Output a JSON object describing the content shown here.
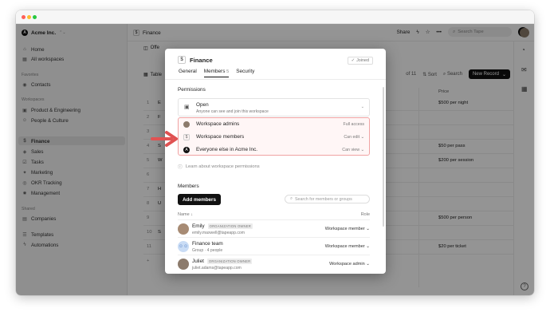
{
  "workspace": {
    "name": "Acme Inc.",
    "logo_letter": "A"
  },
  "sidebar": {
    "top": [
      {
        "icon": "home-icon",
        "glyph": "⌂",
        "label": "Home"
      },
      {
        "icon": "grid-icon",
        "glyph": "▦",
        "label": "All workspaces"
      }
    ],
    "favorites_title": "Favorites",
    "favorites": [
      {
        "icon": "contacts-icon",
        "glyph": "◉",
        "label": "Contacts"
      }
    ],
    "workspaces_title": "Workspaces",
    "workspaces": [
      {
        "icon": "briefcase-icon",
        "glyph": "▣",
        "label": "Product & Engineering"
      },
      {
        "icon": "people-icon",
        "glyph": "☺",
        "label": "People & Culture"
      },
      {
        "icon": "dollar-icon",
        "glyph": "$",
        "label": "Finance"
      },
      {
        "icon": "sales-icon",
        "glyph": "◈",
        "label": "Sales"
      },
      {
        "icon": "tasks-icon",
        "glyph": "☑",
        "label": "Tasks"
      },
      {
        "icon": "marketing-icon",
        "glyph": "✦",
        "label": "Marketing"
      },
      {
        "icon": "okr-icon",
        "glyph": "◎",
        "label": "OKR Tracking"
      },
      {
        "icon": "management-icon",
        "glyph": "✸",
        "label": "Management"
      }
    ],
    "shared_title": "Shared",
    "shared": [
      {
        "icon": "building-icon",
        "glyph": "▤",
        "label": "Companies"
      }
    ],
    "bottom": [
      {
        "icon": "templates-icon",
        "glyph": "☰",
        "label": "Templates"
      },
      {
        "icon": "lightning-icon",
        "glyph": "ϟ",
        "label": "Automations"
      }
    ]
  },
  "topbar": {
    "breadcrumb": "Finance",
    "share": "Share",
    "search_placeholder": "Search Tape"
  },
  "background": {
    "tab": "Offe",
    "table_label": "Table",
    "count": "of 11",
    "sort": "Sort",
    "search": "Search",
    "new_record": "New Record",
    "price_header": "Price",
    "rows": [
      {
        "n": "1",
        "s": "E",
        "p": "$500 per night"
      },
      {
        "n": "2",
        "s": "F",
        "p": ""
      },
      {
        "n": "3",
        "s": "",
        "p": ""
      },
      {
        "n": "4",
        "s": "S",
        "p": "$50 per pass"
      },
      {
        "n": "5",
        "s": "W",
        "p": "$200 per session"
      },
      {
        "n": "6",
        "s": "",
        "p": ""
      },
      {
        "n": "7",
        "s": "H",
        "p": ""
      },
      {
        "n": "8",
        "s": "U",
        "p": ""
      },
      {
        "n": "9",
        "s": "",
        "p": "$500 per person"
      },
      {
        "n": "10",
        "s": "S",
        "p": ""
      },
      {
        "n": "11",
        "s": "",
        "p": "$20 per ticket"
      }
    ]
  },
  "modal": {
    "title": "Finance",
    "joined": "Joined",
    "tabs": [
      {
        "label": "General",
        "active": false
      },
      {
        "label": "Members",
        "badge": "5",
        "active": true
      },
      {
        "label": "Security",
        "active": false
      }
    ],
    "permissions_title": "Permissions",
    "open": {
      "title": "Open",
      "subtitle": "Anyone can see and join this workspace"
    },
    "perm_rows": [
      {
        "label": "Workspace admins",
        "level": "Full access"
      },
      {
        "label": "Workspace members",
        "level": "Can edit"
      },
      {
        "label": "Everyone else in Acme Inc.",
        "level": "Can view"
      }
    ],
    "learn_link": "Learn about workspace permissions",
    "members_title": "Members",
    "add_members": "Add members",
    "search_placeholder": "Search for members or groups",
    "col_name": "Name",
    "col_role": "Role",
    "members": [
      {
        "name": "Emily",
        "tag": "ORGANIZATION OWNER",
        "sub": "emily.maxwell@tapeapp.com",
        "role": "Workspace member",
        "avatar": "#a78b74"
      },
      {
        "name": "Finance team",
        "tag": "",
        "sub": "Group · 4 people",
        "role": "Workspace member",
        "avatar": "#c9dcf5"
      },
      {
        "name": "Juliet",
        "tag": "ORGANIZATION OWNER",
        "sub": "juliet.adams@tapeapp.com",
        "role": "Workspace admin",
        "avatar": "#8c7b6c"
      }
    ]
  },
  "colors": {
    "accent_red": "#e05252",
    "dark": "#111111"
  }
}
